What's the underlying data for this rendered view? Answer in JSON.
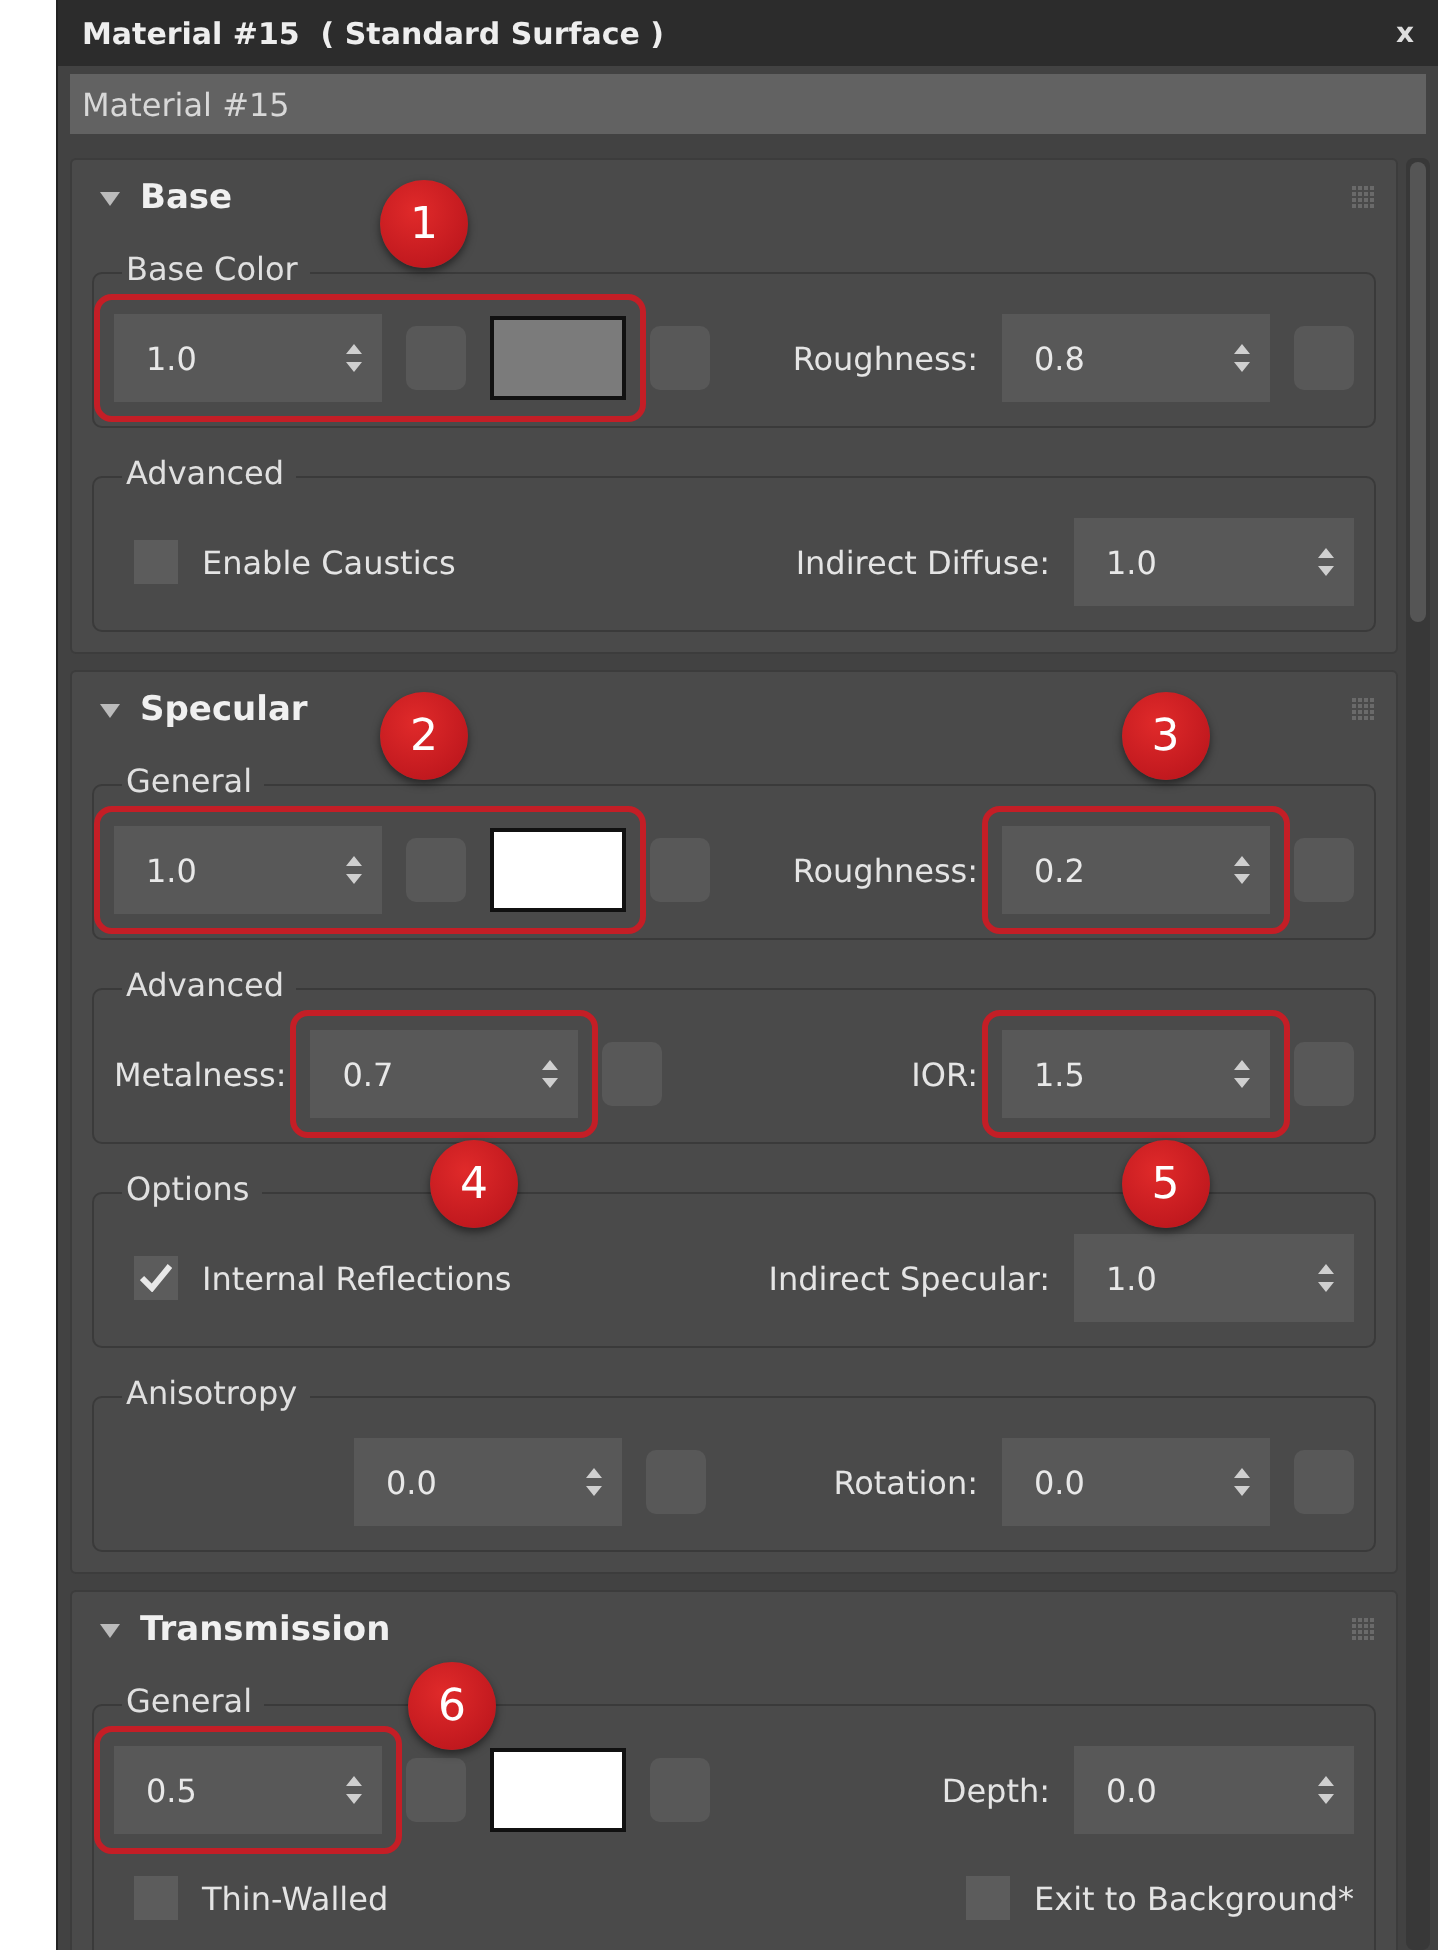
{
  "window": {
    "title": "Material #15  ( Standard Surface )",
    "close": "x"
  },
  "name_field": {
    "value": "Material #15"
  },
  "rollouts": [
    {
      "title": "Base",
      "expanded": true,
      "groups": [
        {
          "title": "Base Color",
          "rows": [
            {
              "left": {
                "items": [
                  {
                    "kind": "highlight",
                    "callout": "1",
                    "items": [
                      {
                        "kind": "spinner",
                        "value": "1.0"
                      },
                      {
                        "kind": "map"
                      },
                      {
                        "kind": "swatch",
                        "color": "#7b7b7b"
                      }
                    ]
                  },
                  {
                    "kind": "map"
                  }
                ]
              },
              "right": {
                "items": [
                  {
                    "kind": "label",
                    "text": "Roughness:"
                  },
                  {
                    "kind": "spinner",
                    "value": "0.8"
                  },
                  {
                    "kind": "map"
                  }
                ]
              }
            }
          ]
        },
        {
          "title": "Advanced",
          "rows": [
            {
              "left": {
                "items": [
                  {
                    "kind": "checkbox",
                    "label": "Enable Caustics",
                    "checked": false
                  }
                ]
              },
              "right": {
                "items": [
                  {
                    "kind": "label",
                    "text": "Indirect Diffuse:"
                  },
                  {
                    "kind": "spinner",
                    "value": "1.0"
                  }
                ]
              }
            }
          ]
        }
      ]
    },
    {
      "title": "Specular",
      "expanded": true,
      "groups": [
        {
          "title": "General",
          "rows": [
            {
              "left": {
                "items": [
                  {
                    "kind": "highlight",
                    "callout": "2",
                    "items": [
                      {
                        "kind": "spinner",
                        "value": "1.0"
                      },
                      {
                        "kind": "map"
                      },
                      {
                        "kind": "swatch",
                        "color": "#ffffff"
                      }
                    ]
                  },
                  {
                    "kind": "map"
                  }
                ]
              },
              "right": {
                "items": [
                  {
                    "kind": "label",
                    "text": "Roughness:"
                  },
                  {
                    "kind": "highlight",
                    "callout": "3",
                    "items": [
                      {
                        "kind": "spinner",
                        "value": "0.2"
                      }
                    ]
                  },
                  {
                    "kind": "map"
                  }
                ]
              }
            }
          ]
        },
        {
          "title": "Advanced",
          "rows": [
            {
              "left": {
                "items": [
                  {
                    "kind": "label",
                    "text": "Metalness:"
                  },
                  {
                    "kind": "highlight",
                    "callout": "4",
                    "items": [
                      {
                        "kind": "spinner",
                        "value": "0.7"
                      }
                    ]
                  },
                  {
                    "kind": "map"
                  }
                ]
              },
              "right": {
                "items": [
                  {
                    "kind": "label",
                    "text": "IOR:"
                  },
                  {
                    "kind": "highlight",
                    "callout": "5",
                    "items": [
                      {
                        "kind": "spinner",
                        "value": "1.5"
                      }
                    ]
                  },
                  {
                    "kind": "map"
                  }
                ]
              }
            }
          ]
        },
        {
          "title": "Options",
          "rows": [
            {
              "left": {
                "items": [
                  {
                    "kind": "checkbox",
                    "label": "Internal Reflections",
                    "checked": true
                  }
                ]
              },
              "right": {
                "items": [
                  {
                    "kind": "label",
                    "text": "Indirect Specular:"
                  },
                  {
                    "kind": "spinner",
                    "value": "1.0"
                  }
                ]
              }
            }
          ]
        },
        {
          "title": "Anisotropy",
          "rows": [
            {
              "left": {
                "items": [
                  {
                    "kind": "spinner",
                    "value": "0.0"
                  },
                  {
                    "kind": "map"
                  }
                ]
              },
              "right": {
                "items": [
                  {
                    "kind": "label",
                    "text": "Rotation:"
                  },
                  {
                    "kind": "spinner",
                    "value": "0.0"
                  },
                  {
                    "kind": "map"
                  }
                ]
              }
            }
          ]
        }
      ]
    },
    {
      "title": "Transmission",
      "expanded": true,
      "groups": [
        {
          "title": "General",
          "rows": [
            {
              "left": {
                "items": [
                  {
                    "kind": "highlight",
                    "callout": "6",
                    "items": [
                      {
                        "kind": "spinner",
                        "value": "0.5"
                      }
                    ]
                  },
                  {
                    "kind": "map"
                  },
                  {
                    "kind": "swatch",
                    "color": "#ffffff"
                  },
                  {
                    "kind": "map"
                  }
                ]
              },
              "right": {
                "items": [
                  {
                    "kind": "label",
                    "text": "Depth:"
                  },
                  {
                    "kind": "spinner",
                    "value": "0.0"
                  }
                ]
              }
            },
            {
              "left": {
                "items": [
                  {
                    "kind": "checkbox",
                    "label": "Thin-Walled",
                    "checked": false
                  }
                ]
              },
              "right": {
                "items": [
                  {
                    "kind": "checkbox",
                    "label": "Exit to Background*",
                    "checked": false
                  }
                ]
              }
            }
          ]
        }
      ]
    }
  ]
}
